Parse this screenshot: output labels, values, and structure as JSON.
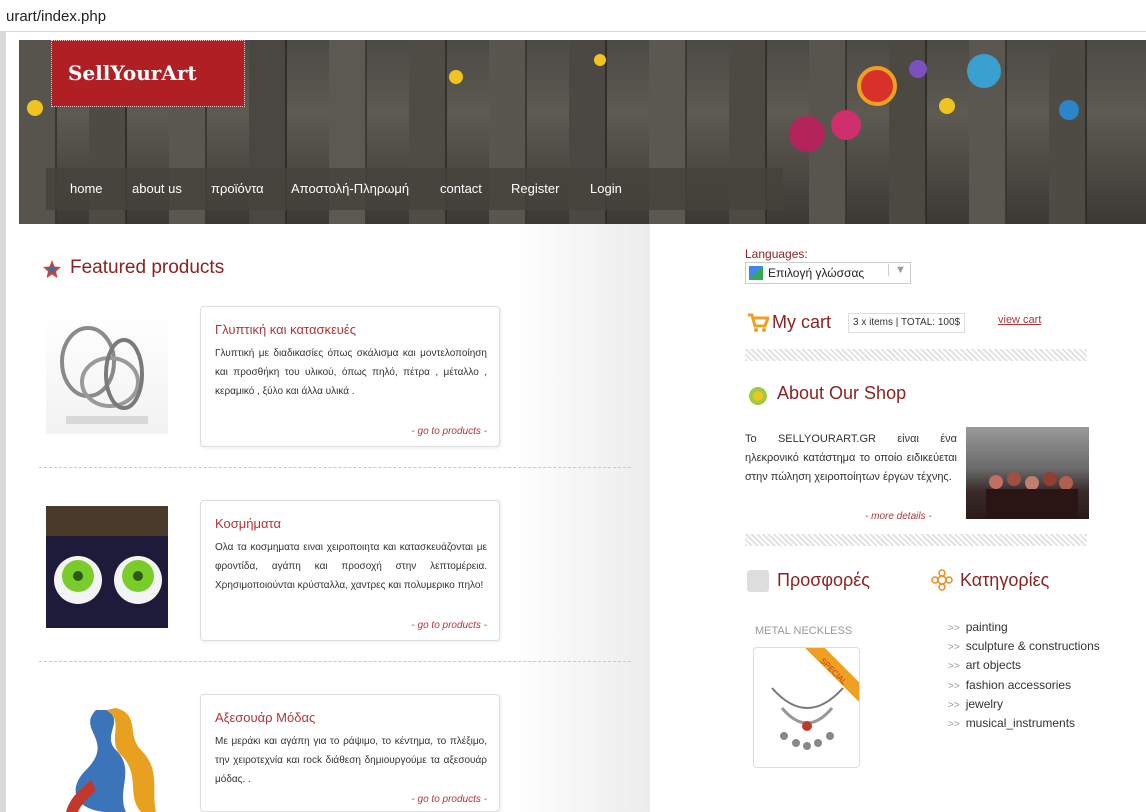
{
  "browser": {
    "url": "urart/index.php"
  },
  "site": {
    "logo_text": "SellYourArt"
  },
  "nav": [
    "home",
    "about us",
    "προϊόντα",
    "Αποστολή-Πληρωμή",
    "contact",
    "Register",
    "Login"
  ],
  "featured": {
    "title": "Featured products",
    "products": [
      {
        "title": "Γλυπτική και κατασκευές",
        "desc": "Γλυπτική με διαδικασίες όπως σκάλισμα και μοντελοποίηση και προσθήκη του υλικού, όπως πηλό, πέτρα , μέταλλο , κεραμικό , ξύλο και άλλα υλικά .",
        "link": "- go to products -"
      },
      {
        "title": "Κοσμήματα",
        "desc": "Ολα τα κοσμηματα ειναι χειροποιητα και κατασκευάζονται με φροντίδα, αγάπη και προσοχή στην λεπτομέρεια. Χρησιμοποιούνται κρύσταλλα, χαντρες και πολυμερικο πηλο!",
        "link": "- go to products -"
      },
      {
        "title": "Αξεσουάρ Μόδας",
        "desc": "Με μεράκι και αγάπη για το ράψιμο, το κέντημα, το πλέξιμο, την χειροτεχνία και rock διάθεση δημιουργούμε τα αξεσουάρ μόδας. .",
        "link": "- go to products -"
      }
    ]
  },
  "languages": {
    "label": "Languages:",
    "select": "Επιλογή γλώσσας"
  },
  "cart": {
    "title": "My cart",
    "info": "3 x items | TOTAL: 100$",
    "view": "view cart"
  },
  "about": {
    "title": "About Our Shop",
    "text": "Το SELLYOURART.GR είναι ένα ηλεκρονικό κατάστημα το οποίο ειδικεύεται στην πώληση χειροποίητων έργων τέχνης.",
    "link": "- more details -"
  },
  "offers": {
    "title": "Προσφορές",
    "item": "METAL NECKLESS",
    "badge": "SPECIAL"
  },
  "categories": {
    "title": "Κατηγορίες",
    "items": [
      "painting",
      "sculpture & constructions",
      "art objects",
      "fashion accessories",
      "jewelry",
      "musical_instruments"
    ]
  },
  "colors": {
    "accent": "#8a2323",
    "logo_bg": "#b01f24",
    "link": "#b0363b"
  }
}
